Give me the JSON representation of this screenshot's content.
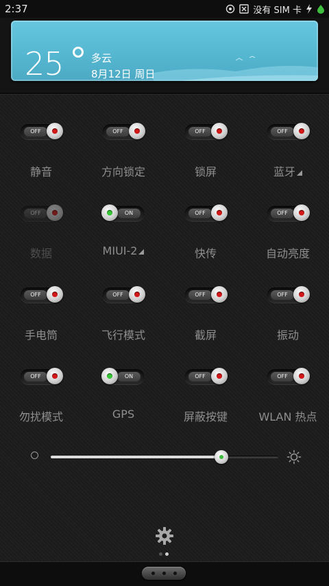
{
  "status_bar": {
    "time": "2:37",
    "carrier": "没有 SIM 卡",
    "icons": [
      "location-icon",
      "no-sim-icon",
      "charging-icon",
      "battery-icon"
    ]
  },
  "weather": {
    "temperature": "25",
    "condition": "多云",
    "date": "8月12日 周日",
    "background_color": "#5fc0da"
  },
  "quick_toggles": [
    {
      "label": "静音",
      "state": "OFF",
      "on": false
    },
    {
      "label": "方向锁定",
      "state": "OFF",
      "on": false
    },
    {
      "label": "锁屏",
      "state": "OFF",
      "on": false
    },
    {
      "label": "蓝牙",
      "state": "OFF",
      "on": false,
      "has_menu": true
    },
    {
      "label": "数据",
      "state": "OFF",
      "on": false,
      "disabled": true
    },
    {
      "label": "MIUI-2",
      "state": "ON",
      "on": true,
      "has_menu": true
    },
    {
      "label": "快传",
      "state": "OFF",
      "on": false
    },
    {
      "label": "自动亮度",
      "state": "OFF",
      "on": false
    },
    {
      "label": "手电筒",
      "state": "OFF",
      "on": false
    },
    {
      "label": "飞行模式",
      "state": "OFF",
      "on": false
    },
    {
      "label": "截屏",
      "state": "OFF",
      "on": false
    },
    {
      "label": "振动",
      "state": "OFF",
      "on": false
    },
    {
      "label": "勿扰模式",
      "state": "OFF",
      "on": false
    },
    {
      "label": "GPS",
      "state": "ON",
      "on": true
    },
    {
      "label": "屏蔽按键",
      "state": "OFF",
      "on": false
    },
    {
      "label": "WLAN 热点",
      "state": "OFF",
      "on": false
    }
  ],
  "brightness": {
    "level": 0.75,
    "min_icon": "brightness-low-icon",
    "max_icon": "brightness-high-icon"
  },
  "settings_icon": "gear-icon",
  "pager": {
    "total": 2,
    "active": 1
  },
  "colors": {
    "off_indicator": "#d21818",
    "on_indicator": "#37c837"
  }
}
